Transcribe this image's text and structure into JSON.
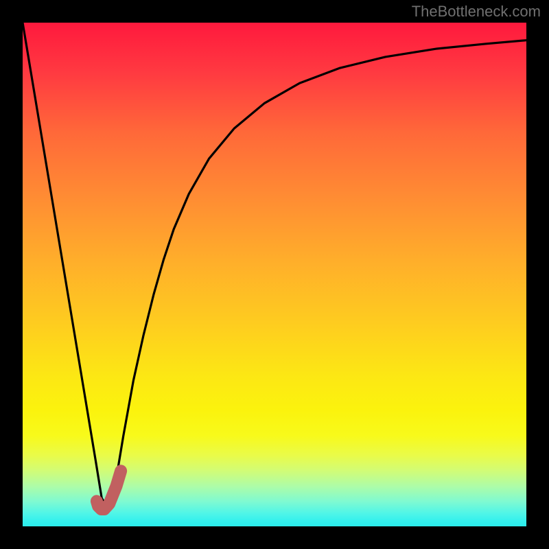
{
  "watermark": "TheBottleneck.com",
  "chart_data": {
    "type": "line",
    "title": "",
    "xlabel": "",
    "ylabel": "",
    "xlim": [
      0,
      100
    ],
    "ylim": [
      0,
      100
    ],
    "grid": false,
    "series": [
      {
        "name": "curve",
        "color": "#000000",
        "x": [
          0,
          3,
          6,
          9,
          12,
          14.5,
          15.7,
          17,
          18.5,
          20,
          22,
          24,
          26,
          28,
          30,
          33,
          37,
          42,
          48,
          55,
          63,
          72,
          82,
          92,
          100
        ],
        "values": [
          100,
          82,
          64,
          46,
          28,
          13,
          5.6,
          3.5,
          9,
          18,
          29,
          38,
          46,
          53,
          59,
          66,
          73,
          79,
          84,
          88,
          91,
          93.2,
          94.8,
          95.8,
          96.5
        ]
      },
      {
        "name": "marker",
        "color": "#c16060",
        "x": [
          14.7,
          15,
          15.6,
          16.2,
          17.2,
          18.6,
          19.5
        ],
        "values": [
          5.0,
          4.0,
          3.4,
          3.4,
          4.5,
          8.0,
          11.0
        ]
      }
    ]
  }
}
